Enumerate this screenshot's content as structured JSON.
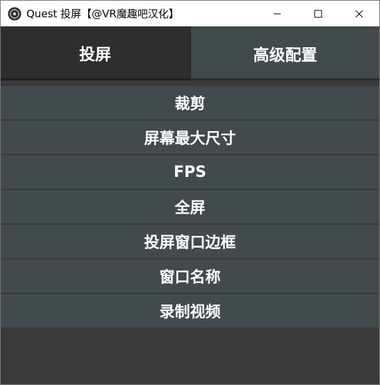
{
  "window": {
    "title": "Quest 投屏【@VR魔趣吧汉化】"
  },
  "tabs": [
    {
      "label": "投屏",
      "active": true
    },
    {
      "label": "高级配置",
      "active": false
    }
  ],
  "menu": {
    "items": [
      {
        "label": "裁剪"
      },
      {
        "label": "屏幕最大尺寸"
      },
      {
        "label": "FPS"
      },
      {
        "label": "全屏"
      },
      {
        "label": "投屏窗口边框"
      },
      {
        "label": "窗口名称"
      },
      {
        "label": "录制视频"
      }
    ]
  },
  "colors": {
    "tab_active": "#2e2e2e",
    "tab_inactive": "#434a4d",
    "menu_item": "#434a4d",
    "background": "#3a3a3a"
  },
  "icons": {
    "app": "quest-app-icon",
    "minimize": "minimize-icon",
    "maximize": "maximize-icon",
    "close": "close-icon"
  }
}
